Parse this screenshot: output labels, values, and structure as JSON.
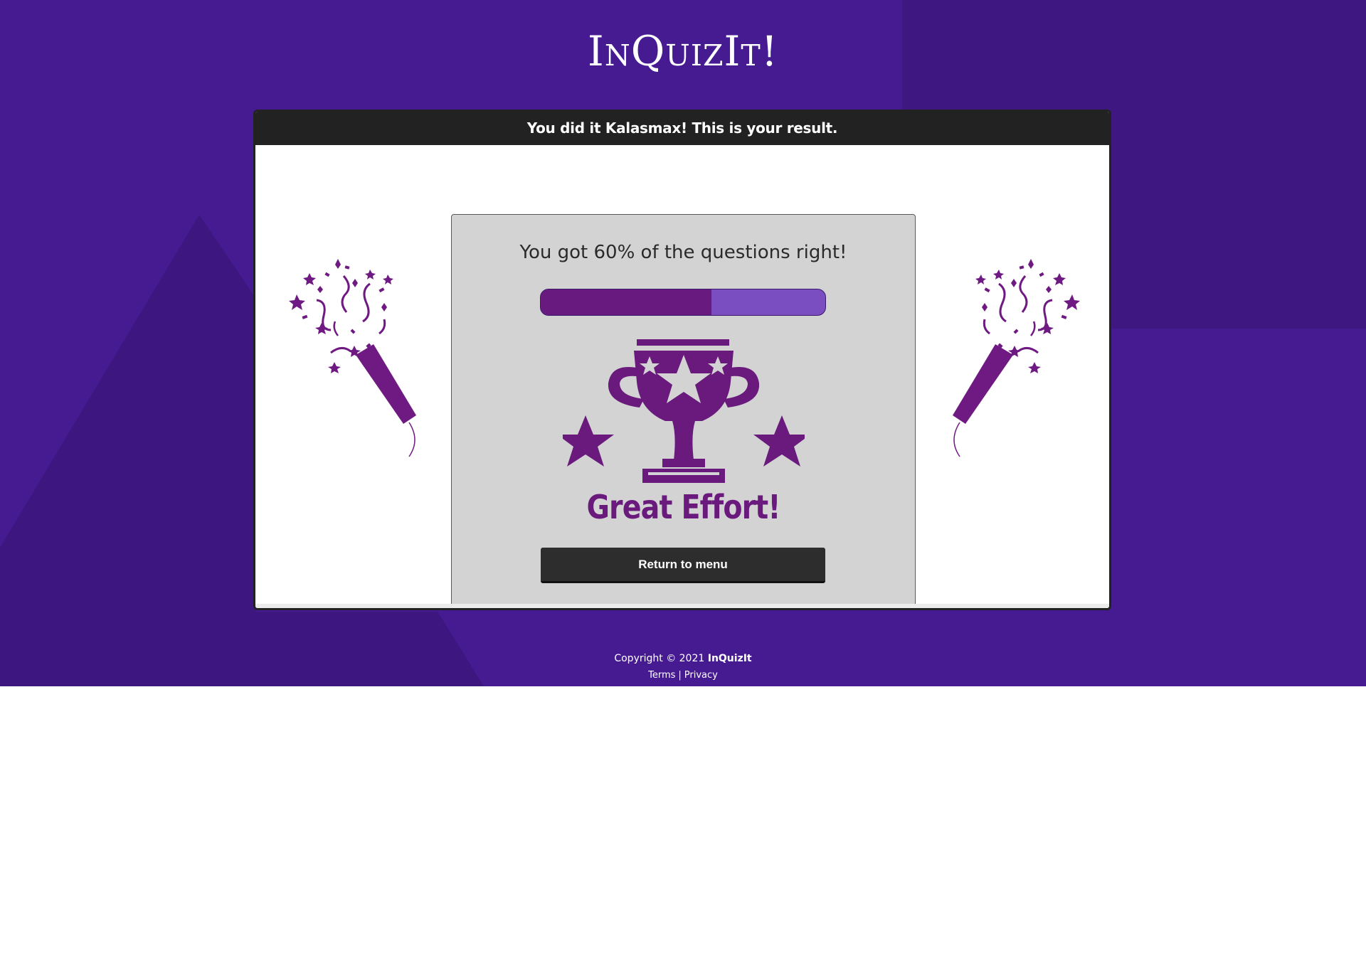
{
  "app": {
    "logo_text": "InQuizIt!"
  },
  "card": {
    "header_text": "You did it Kalasmax! This is your result."
  },
  "result": {
    "score_text": "You got 60% of the questions right!",
    "progress_fraction": 0.6,
    "badge_text": "Great Effort!",
    "return_button_label": "Return to menu"
  },
  "footer": {
    "copyright_prefix": "Copyright © 2021",
    "brand": "InQuizIt",
    "terms_label": "Terms",
    "separator": "|",
    "privacy_label": "Privacy"
  },
  "colors": {
    "background_purple": "#461b91",
    "accent_purple": "#681a7e",
    "progress_track": "#7a4ec0",
    "header_dark": "#222222",
    "result_box_gray": "#d3d3d3",
    "button_dark": "#2d2d2d"
  },
  "icons": {
    "left_decoration": "party-popper-icon",
    "right_decoration": "party-popper-icon",
    "trophy": "trophy-icon"
  }
}
